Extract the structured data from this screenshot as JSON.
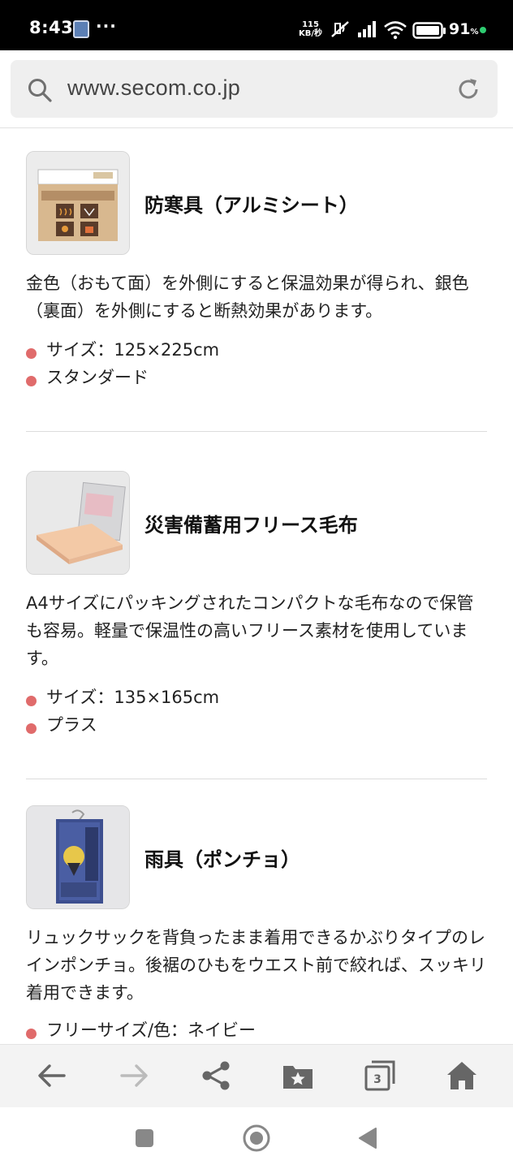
{
  "status_bar": {
    "time": "8:43",
    "more": "···",
    "speed_value": "115",
    "speed_unit": "KB/秒",
    "battery_percent": "91",
    "battery_symbol": "%"
  },
  "browser": {
    "url": "www.secom.co.jp",
    "tab_count": "3"
  },
  "products": [
    {
      "title": "防寒具（アルミシート）",
      "description": "金色（おもて面）を外側にすると保温効果が得られ、銀色（裏面）を外側にすると断熱効果があります。",
      "specs": [
        "サイズ：125×225cm",
        "スタンダード"
      ]
    },
    {
      "title": "災害備蓄用フリース毛布",
      "description": "A4サイズにパッキングされたコンパクトな毛布なので保管も容易。軽量で保温性の高いフリース素材を使用しています。",
      "specs": [
        "サイズ：135×165cm",
        "プラス"
      ]
    },
    {
      "title": "雨具（ポンチョ）",
      "description": "リュックサックを背負ったまま着用できるかぶりタイプのレインポンチョ。後裾のひもをウエスト前で絞れば、スッキリ着用できます。",
      "specs": [
        "フリーサイズ/色：ネイビー"
      ]
    }
  ],
  "colors": {
    "bullet": "#e06b6b",
    "toolbar_bg": "#f3f3f3",
    "url_box_bg": "#efefef",
    "icon_gray": "#666666",
    "icon_disabled": "#bbbbbb"
  },
  "icons": {
    "status": [
      "app-notification-icon",
      "mute-icon",
      "signal-icon",
      "wifi-icon",
      "battery-icon"
    ],
    "url_bar": [
      "search-icon",
      "reload-icon"
    ],
    "toolbar": [
      "back-arrow-icon",
      "forward-arrow-icon",
      "share-icon",
      "bookmark-folder-icon",
      "tabs-icon",
      "home-icon"
    ],
    "system_nav": [
      "recents-icon",
      "home-circle-icon",
      "back-triangle-icon"
    ]
  }
}
